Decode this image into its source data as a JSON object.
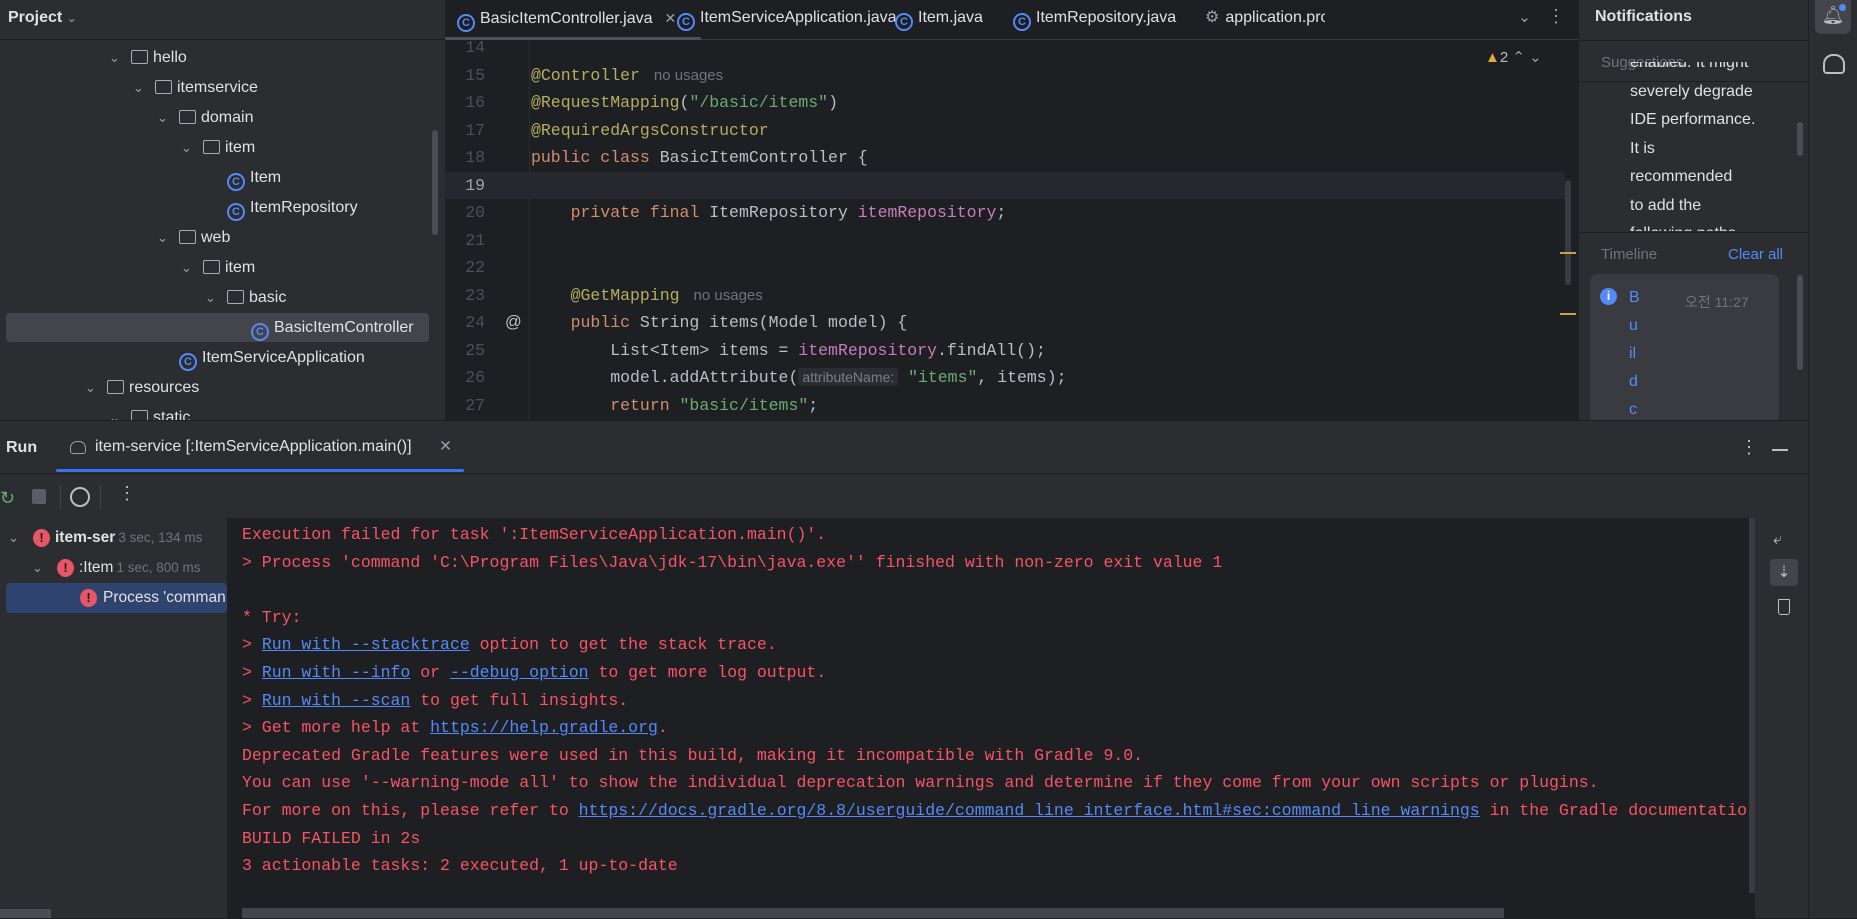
{
  "project": {
    "title": "Project",
    "tree": [
      {
        "label": "hello",
        "type": "folder",
        "level": 0,
        "chev": true
      },
      {
        "label": "itemservice",
        "type": "folder",
        "level": 1,
        "chev": true
      },
      {
        "label": "domain",
        "type": "folder",
        "level": 2,
        "chev": true
      },
      {
        "label": "item",
        "type": "folder",
        "level": 3,
        "chev": true
      },
      {
        "label": "Item",
        "type": "class",
        "level": 4,
        "chev": false
      },
      {
        "label": "ItemRepository",
        "type": "class",
        "level": 4,
        "chev": false
      },
      {
        "label": "web",
        "type": "folder",
        "level": 2,
        "chev": true
      },
      {
        "label": "item",
        "type": "folder",
        "level": 3,
        "chev": true
      },
      {
        "label": "basic",
        "type": "folder",
        "level": 4,
        "chev": true
      },
      {
        "label": "BasicItemController",
        "type": "class",
        "level": 5,
        "chev": false,
        "selected": true
      },
      {
        "label": "ItemServiceApplication",
        "type": "app",
        "level": 2,
        "chev": false
      },
      {
        "label": "resources",
        "type": "folder",
        "level": -1,
        "chev": true
      },
      {
        "label": "static",
        "type": "folder",
        "level": 0,
        "chev": true
      }
    ]
  },
  "editor": {
    "tabs": [
      {
        "label": "BasicItemController.java",
        "icon": "class-icon",
        "active": true
      },
      {
        "label": "ItemServiceApplication.java",
        "icon": "app-icon"
      },
      {
        "label": "Item.java",
        "icon": "class-icon"
      },
      {
        "label": "ItemRepository.java",
        "icon": "class-icon"
      },
      {
        "label": "application.pro",
        "icon": "gear-icon"
      }
    ],
    "warnings": "2",
    "lines": [
      {
        "n": "14",
        "segs": []
      },
      {
        "n": "15",
        "segs": [
          {
            "t": "@Controller",
            "c": "ann"
          }
        ],
        "hint": "no usages"
      },
      {
        "n": "16",
        "segs": [
          {
            "t": "@RequestMapping",
            "c": "ann"
          },
          {
            "t": "(",
            "c": "def"
          },
          {
            "t": "\"/basic/items\"",
            "c": "str"
          },
          {
            "t": ")",
            "c": "def"
          }
        ]
      },
      {
        "n": "17",
        "segs": [
          {
            "t": "@RequiredArgsConstructor",
            "c": "ann"
          }
        ]
      },
      {
        "n": "18",
        "segs": [
          {
            "t": "public class ",
            "c": "kw"
          },
          {
            "t": "BasicItemController {",
            "c": "def"
          }
        ]
      },
      {
        "n": "19",
        "segs": [],
        "current": true
      },
      {
        "n": "20",
        "segs": [
          {
            "t": "    private final ",
            "c": "kw"
          },
          {
            "t": "ItemRepository ",
            "c": "def"
          },
          {
            "t": "itemRepository",
            "c": "fld"
          },
          {
            "t": ";",
            "c": "def"
          }
        ]
      },
      {
        "n": "21",
        "segs": []
      },
      {
        "n": "22",
        "segs": []
      },
      {
        "n": "23",
        "segs": [
          {
            "t": "    @GetMapping",
            "c": "ann"
          }
        ],
        "hint": "no usages"
      },
      {
        "n": "24",
        "segs": [
          {
            "t": "    public ",
            "c": "kw"
          },
          {
            "t": "String ",
            "c": "def"
          },
          {
            "t": "items",
            "c": "mth"
          },
          {
            "t": "(Model model) {",
            "c": "def"
          }
        ],
        "marker": "@"
      },
      {
        "n": "25",
        "segs": [
          {
            "t": "        List<Item> items = ",
            "c": "def"
          },
          {
            "t": "itemRepository",
            "c": "fld"
          },
          {
            "t": ".findAll();",
            "c": "def"
          }
        ]
      },
      {
        "n": "26",
        "segs": [
          {
            "t": "        model.addAttribute(",
            "c": "def"
          },
          {
            "t": "attributeName:",
            "c": "inlay"
          },
          {
            "t": " ",
            "c": "def"
          },
          {
            "t": "\"items\"",
            "c": "str"
          },
          {
            "t": ", items);",
            "c": "def"
          }
        ]
      },
      {
        "n": "27",
        "segs": [
          {
            "t": "        return ",
            "c": "kw"
          },
          {
            "t": "\"basic/items\"",
            "c": "str"
          },
          {
            "t": ";",
            "c": "def"
          }
        ]
      }
    ]
  },
  "notifications": {
    "title": "Notifications",
    "suggestions": "Suggestions",
    "suggestion_lines": [
      "enabled. It might",
      "severely degrade",
      "IDE performance.",
      "It is",
      "recommended",
      "to add the",
      "following paths"
    ],
    "timeline": "Timeline",
    "clear_all": "Clear all",
    "card_title_chars": [
      "B",
      "u",
      "il",
      "d",
      "c"
    ],
    "card_time": "오전 11:27"
  },
  "run": {
    "title": "Run",
    "tab": "item-service [:ItemServiceApplication.main()]",
    "tree": [
      {
        "label": "item-ser",
        "time": "3 sec, 134 ms",
        "level": 0,
        "bold": true
      },
      {
        "label": ":Item",
        "time": "1 sec, 800 ms",
        "level": 1
      },
      {
        "label": "Process 'comman",
        "time": "",
        "level": 2,
        "selected": true
      }
    ],
    "console": [
      [
        {
          "t": "Execution failed for task ':ItemServiceApplication.main()'."
        }
      ],
      [
        {
          "t": "> Process 'command 'C:\\Program Files\\Java\\jdk-17\\bin\\java.exe'' finished with non-zero exit value 1"
        }
      ],
      [],
      [
        {
          "t": "* Try:"
        }
      ],
      [
        {
          "t": "> "
        },
        {
          "t": "Run with --stacktrace",
          "l": 1
        },
        {
          "t": " option to get the stack trace."
        }
      ],
      [
        {
          "t": "> "
        },
        {
          "t": "Run with --info",
          "l": 1
        },
        {
          "t": " or "
        },
        {
          "t": "--debug option",
          "l": 1
        },
        {
          "t": " to get more log output."
        }
      ],
      [
        {
          "t": "> "
        },
        {
          "t": "Run with --scan",
          "l": 1
        },
        {
          "t": " to get full insights."
        }
      ],
      [
        {
          "t": "> Get more help at "
        },
        {
          "t": "https://help.gradle.org",
          "l": 1
        },
        {
          "t": "."
        }
      ],
      [
        {
          "t": "Deprecated Gradle features were used in this build, making it incompatible with Gradle 9.0."
        }
      ],
      [
        {
          "t": "You can use '--warning-mode all' to show the individual deprecation warnings and determine if they come from your own scripts or plugins."
        }
      ],
      [
        {
          "t": "For more on this, please refer to "
        },
        {
          "t": "https://docs.gradle.org/8.8/userguide/command_line_interface.html#sec:command_line_warnings",
          "l": 1
        },
        {
          "t": " in the Gradle documentatio"
        }
      ],
      [
        {
          "t": "BUILD FAILED in 2s"
        }
      ],
      [
        {
          "t": "3 actionable tasks: 2 executed, 1 up-to-date"
        }
      ]
    ]
  },
  "colors": {
    "ann": "#b3ae60",
    "kw": "#cf8e6d",
    "str": "#6aab73",
    "fld": "#c77dbb",
    "def": "#bcbec4",
    "mth": "#bcbec4",
    "error": "#f75464",
    "link": "#548af7",
    "accent": "#3574f0"
  }
}
